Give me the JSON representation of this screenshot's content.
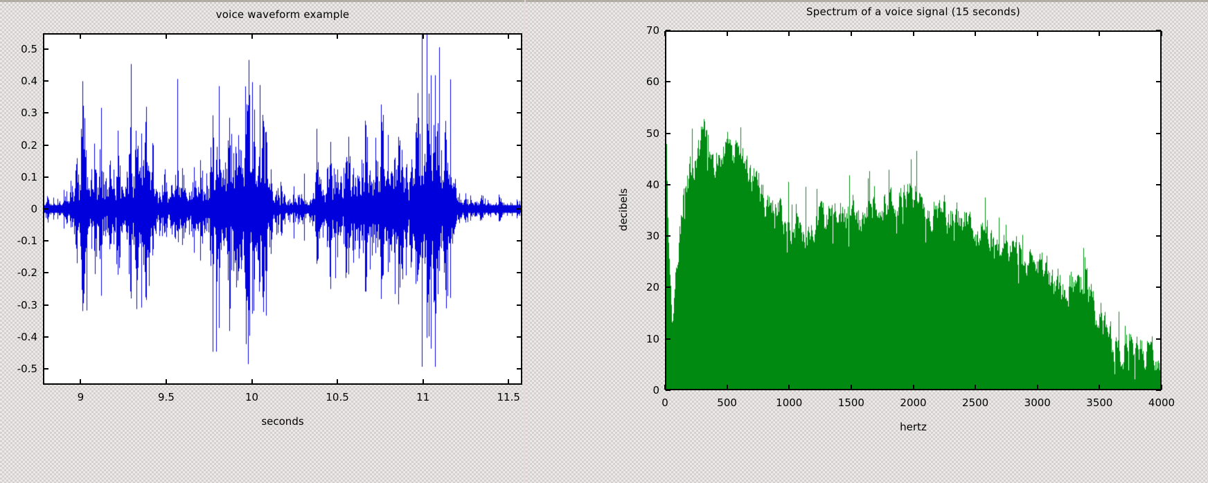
{
  "figure": {
    "background_color": "#d4d0c8",
    "panel_divider_color": "#e7d8e0"
  },
  "chart_data": [
    {
      "type": "line",
      "id": "voice-waveform",
      "title": "voice waveform example",
      "xlabel": "seconds",
      "ylabel": "",
      "color": "#0000dd",
      "xlim": [
        8.78,
        11.58
      ],
      "ylim": [
        -0.55,
        0.55
      ],
      "xticks": [
        9,
        9.5,
        10,
        10.5,
        11,
        11.5
      ],
      "xticklabels": [
        "9",
        "9.5",
        "10",
        "10.5",
        "11",
        "11.5"
      ],
      "yticks": [
        -0.5,
        -0.4,
        -0.3,
        -0.2,
        -0.1,
        0,
        0.1,
        0.2,
        0.3,
        0.4,
        0.5
      ],
      "yticklabels": [
        "-0.5",
        "-0.4",
        "-0.3",
        "-0.2",
        "-0.1",
        "0",
        "0.1",
        "0.2",
        "0.3",
        "0.4",
        "0.5"
      ],
      "grid": false,
      "seed": 20240617,
      "description": "dense audio waveform, symmetric about zero, alternating loud speech bursts and quieter gaps",
      "envelope_x": [
        8.78,
        8.84,
        8.9,
        8.95,
        9.0,
        9.05,
        9.12,
        9.2,
        9.28,
        9.34,
        9.4,
        9.44,
        9.5,
        9.56,
        9.62,
        9.7,
        9.76,
        9.8,
        9.86,
        9.92,
        9.98,
        10.04,
        10.08,
        10.12,
        10.18,
        10.26,
        10.34,
        10.4,
        10.46,
        10.54,
        10.62,
        10.7,
        10.78,
        10.86,
        10.94,
        11.0,
        11.06,
        11.1,
        11.14,
        11.18,
        11.24,
        11.3,
        11.38,
        11.46,
        11.54,
        11.58
      ],
      "envelope_y": [
        0.02,
        0.03,
        0.05,
        0.12,
        0.3,
        0.2,
        0.14,
        0.17,
        0.22,
        0.31,
        0.28,
        0.12,
        0.1,
        0.13,
        0.12,
        0.1,
        0.2,
        0.3,
        0.25,
        0.34,
        0.4,
        0.36,
        0.3,
        0.1,
        0.06,
        0.05,
        0.06,
        0.18,
        0.2,
        0.16,
        0.22,
        0.2,
        0.24,
        0.26,
        0.22,
        0.3,
        0.36,
        0.45,
        0.3,
        0.12,
        0.05,
        0.04,
        0.03,
        0.03,
        0.02,
        0.02
      ],
      "notable_peaks": [
        {
          "x": 11.1,
          "y": 0.51
        },
        {
          "x": 9.98,
          "y": 0.47
        },
        {
          "x": 9.56,
          "y": 0.41
        },
        {
          "x": 10.0,
          "y": 0.4
        },
        {
          "x": 9.79,
          "y": -0.45
        },
        {
          "x": 11.08,
          "y": -0.33
        },
        {
          "x": 9.03,
          "y": -0.32
        }
      ]
    },
    {
      "type": "area",
      "id": "voice-spectrum",
      "title": "Spectrum of a voice signal (15 seconds)",
      "xlabel": "hertz",
      "ylabel": "decibels",
      "color": "#008a12",
      "xlim": [
        0,
        4000
      ],
      "ylim": [
        0,
        70
      ],
      "xticks": [
        0,
        500,
        1000,
        1500,
        2000,
        2500,
        3000,
        3500,
        4000
      ],
      "xticklabels": [
        "0",
        "500",
        "1000",
        "1500",
        "2000",
        "2500",
        "3000",
        "3500",
        "4000"
      ],
      "yticks": [
        0,
        10,
        20,
        30,
        40,
        50,
        60,
        70
      ],
      "yticklabels": [
        "0",
        "10",
        "20",
        "30",
        "40",
        "50",
        "60",
        "70"
      ],
      "grid": false,
      "seed": 771133,
      "description": "filled spectral magnitude: DC spike ~48 dB, dip to ~13 dB near 40 Hz, broad formant region 200-2000 Hz around 40-50 dB, gradual rolloff to ~5 dB at 4000 Hz",
      "x": [
        0,
        20,
        40,
        60,
        100,
        150,
        200,
        250,
        300,
        350,
        400,
        450,
        500,
        550,
        600,
        650,
        700,
        750,
        800,
        900,
        1000,
        1100,
        1200,
        1300,
        1400,
        1500,
        1600,
        1700,
        1800,
        1900,
        1950,
        2000,
        2100,
        2200,
        2300,
        2400,
        2500,
        2600,
        2700,
        2800,
        2900,
        3000,
        3100,
        3200,
        3300,
        3400,
        3500,
        3600,
        3700,
        3800,
        3900,
        4000
      ],
      "y": [
        48,
        30,
        13,
        15,
        30,
        40,
        43,
        46,
        50,
        45,
        46,
        47,
        49,
        46,
        44,
        43,
        41,
        40,
        37,
        35,
        32,
        31,
        33,
        34,
        33,
        35,
        34,
        37,
        36,
        39,
        38,
        39,
        36,
        35,
        34,
        33,
        31,
        30,
        29,
        27,
        26,
        24,
        22,
        20,
        21,
        20,
        13,
        9,
        8,
        7,
        7,
        6
      ]
    }
  ]
}
